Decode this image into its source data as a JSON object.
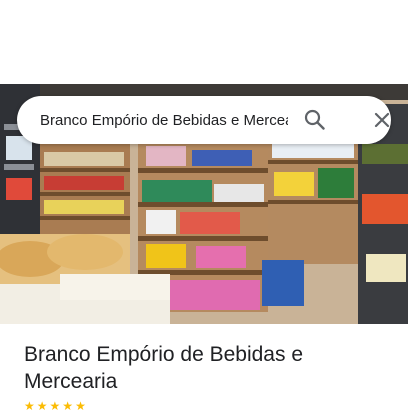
{
  "search": {
    "query": "Branco Empório de Bebidas e Mercearia",
    "search_icon": "search-icon",
    "close_icon": "close-icon"
  },
  "photo": {
    "subject": "store-interior-shelves-photo"
  },
  "place": {
    "title": "Branco Empório de Bebidas e Mercearia"
  },
  "colors": {
    "icon_gray": "#5f6368",
    "title_text": "#202124",
    "star": "#fbbc04"
  }
}
